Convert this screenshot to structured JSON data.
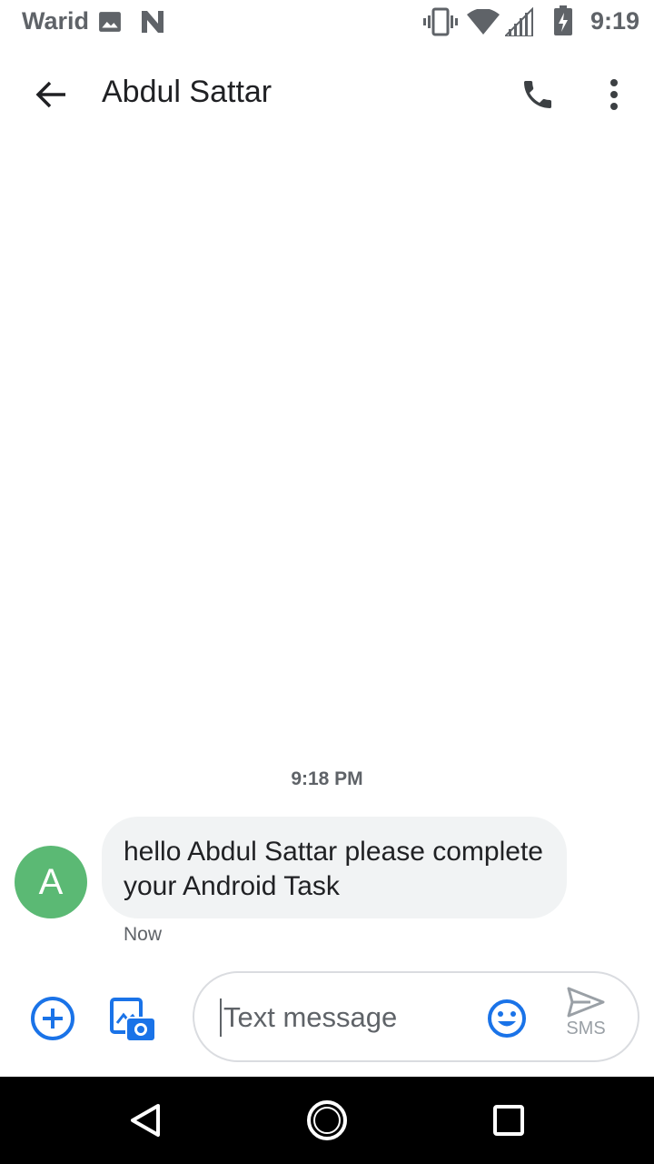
{
  "status_bar": {
    "carrier": "Warid",
    "time": "9:19",
    "icons": [
      "image-notification-icon",
      "n-notification-icon",
      "vibrate-icon",
      "wifi-icon",
      "cell-signal-icon",
      "battery-icon"
    ]
  },
  "app_bar": {
    "title": "Abdul Sattar",
    "back_icon": "arrow-back-icon",
    "call_icon": "phone-icon",
    "more_icon": "more-vert-icon"
  },
  "conversation": {
    "timestamp": "9:18 PM",
    "messages": [
      {
        "sender_initial": "A",
        "text": "hello Abdul Sattar please complete your Android Task",
        "time": "Now"
      }
    ]
  },
  "compose": {
    "placeholder": "Text message",
    "send_label": "SMS",
    "icons": [
      "add-circle-icon",
      "gallery-camera-icon",
      "emoji-icon",
      "send-icon"
    ]
  },
  "nav_bar": {
    "icons": [
      "nav-back-icon",
      "nav-home-icon",
      "nav-recents-icon"
    ]
  },
  "colors": {
    "accent": "#1a73e8",
    "avatar": "#5bb974",
    "bubble": "#f1f3f4",
    "nav_bar": "#000000"
  }
}
